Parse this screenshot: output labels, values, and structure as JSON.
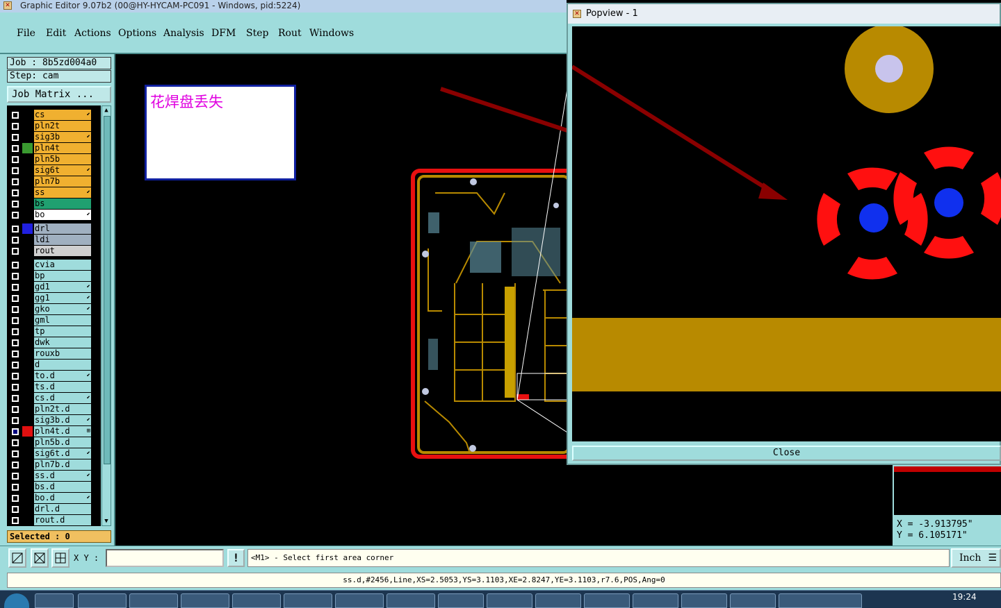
{
  "window": {
    "title": "Graphic Editor 9.07b2 (00@HY-HYCAM-PC091 - Windows, pid:5224)"
  },
  "menu": [
    "File",
    "Edit",
    "Actions",
    "Options",
    "Analysis",
    "DFM",
    "Step",
    "Rout",
    "Windows"
  ],
  "job": {
    "job": "Job : 8b5zd004a0",
    "step": "Step: cam",
    "matrix": "Job Matrix ..."
  },
  "layers": [
    {
      "name": "cs",
      "color": "#f0b030",
      "swatch": "#000000",
      "edit": "⬋"
    },
    {
      "name": "pln2t",
      "color": "#f0b030",
      "swatch": "#000000",
      "edit": ""
    },
    {
      "name": "sig3b",
      "color": "#f0b030",
      "swatch": "#000000",
      "edit": "⬋"
    },
    {
      "name": "pln4t",
      "color": "#f0b030",
      "swatch": "#3a9a30",
      "edit": ""
    },
    {
      "name": "pln5b",
      "color": "#f0b030",
      "swatch": "#000000",
      "edit": ""
    },
    {
      "name": "sig6t",
      "color": "#f0b030",
      "swatch": "#000000",
      "edit": "⬋"
    },
    {
      "name": "pln7b",
      "color": "#f0b030",
      "swatch": "#000000",
      "edit": ""
    },
    {
      "name": "ss",
      "color": "#f0b030",
      "swatch": "#000000",
      "edit": "⬋"
    },
    {
      "name": "bs",
      "color": "#20a070",
      "swatch": "#000000",
      "edit": ""
    },
    {
      "name": "bo",
      "color": "#ffffff",
      "swatch": "#000000",
      "edit": "⬋"
    },
    {
      "name": "drl",
      "color": "#a0b0c0",
      "swatch": "#2020e0",
      "edit": ""
    },
    {
      "name": "ldi",
      "color": "#a0b0c0",
      "swatch": "#000000",
      "edit": ""
    },
    {
      "name": "rout",
      "color": "#d0d0d0",
      "swatch": "#000000",
      "edit": ""
    },
    {
      "name": "cvia",
      "color": "#9fdcdc",
      "swatch": "#000000",
      "edit": ""
    },
    {
      "name": "bp",
      "color": "#9fdcdc",
      "swatch": "#000000",
      "edit": ""
    },
    {
      "name": "gd1",
      "color": "#9fdcdc",
      "swatch": "#000000",
      "edit": "⬋"
    },
    {
      "name": "gg1",
      "color": "#9fdcdc",
      "swatch": "#000000",
      "edit": "⬋"
    },
    {
      "name": "gko",
      "color": "#9fdcdc",
      "swatch": "#000000",
      "edit": "⬋"
    },
    {
      "name": "gml",
      "color": "#9fdcdc",
      "swatch": "#000000",
      "edit": ""
    },
    {
      "name": "tp",
      "color": "#9fdcdc",
      "swatch": "#000000",
      "edit": ""
    },
    {
      "name": "dwk",
      "color": "#9fdcdc",
      "swatch": "#000000",
      "edit": ""
    },
    {
      "name": "rouxb",
      "color": "#9fdcdc",
      "swatch": "#000000",
      "edit": ""
    },
    {
      "name": "d",
      "color": "#9fdcdc",
      "swatch": "#000000",
      "edit": ""
    },
    {
      "name": "to.d",
      "color": "#9fdcdc",
      "swatch": "#000000",
      "edit": "⬋"
    },
    {
      "name": "ts.d",
      "color": "#9fdcdc",
      "swatch": "#000000",
      "edit": ""
    },
    {
      "name": "cs.d",
      "color": "#9fdcdc",
      "swatch": "#000000",
      "edit": "⬋"
    },
    {
      "name": "pln2t.d",
      "color": "#9fdcdc",
      "swatch": "#000000",
      "edit": ""
    },
    {
      "name": "sig3b.d",
      "color": "#9fdcdc",
      "swatch": "#000000",
      "edit": "⬋"
    },
    {
      "name": "pln4t.d",
      "color": "#9fdcdc",
      "swatch": "#e01010",
      "edit": "⊞",
      "checked": true
    },
    {
      "name": "pln5b.d",
      "color": "#9fdcdc",
      "swatch": "#000000",
      "edit": ""
    },
    {
      "name": "sig6t.d",
      "color": "#9fdcdc",
      "swatch": "#000000",
      "edit": "⬋"
    },
    {
      "name": "pln7b.d",
      "color": "#9fdcdc",
      "swatch": "#000000",
      "edit": ""
    },
    {
      "name": "ss.d",
      "color": "#9fdcdc",
      "swatch": "#000000",
      "edit": "⬋"
    },
    {
      "name": "bs.d",
      "color": "#9fdcdc",
      "swatch": "#000000",
      "edit": ""
    },
    {
      "name": "bo.d",
      "color": "#9fdcdc",
      "swatch": "#000000",
      "edit": "⬋"
    },
    {
      "name": "drl.d",
      "color": "#9fdcdc",
      "swatch": "#000000",
      "edit": ""
    },
    {
      "name": "rout.d",
      "color": "#9fdcdc",
      "swatch": "#000000",
      "edit": ""
    }
  ],
  "selected": "Selected : 0",
  "note": {
    "text": "花焊盘丢失"
  },
  "popview": {
    "title": "Popview - 1",
    "close": "Close"
  },
  "coords": {
    "x": "X = -3.913795\"",
    "y": "Y = 6.105171\""
  },
  "command": {
    "xy_label": "X Y :",
    "xy_value": "",
    "excl": "!",
    "prompt": "<M1> - Select first area corner",
    "units": "Inch"
  },
  "status": "ss.d,#2456,Line,XS=2.5053,YS=3.1103,XE=2.8247,YE=3.1103,r7.6,POS,Ang=0",
  "taskbar": {
    "clock": "19:24"
  },
  "icons": {
    "app": "graphic-editor-icon",
    "tool1": "zoom-area-icon",
    "tool2": "measure-icon",
    "tool3": "grid-icon",
    "units_menu": "menu-lines-icon"
  }
}
